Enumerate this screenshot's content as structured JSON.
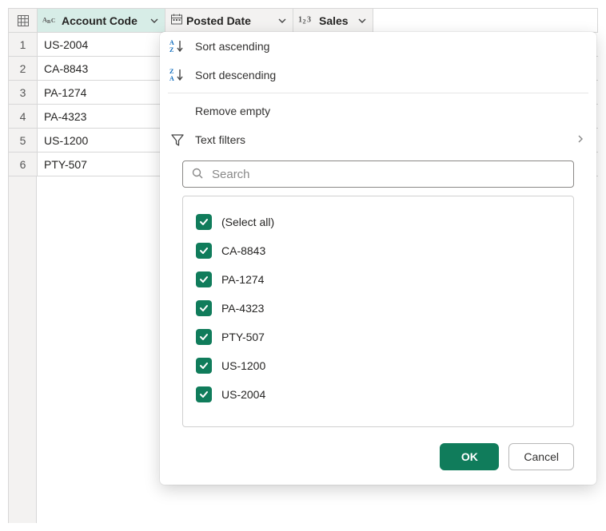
{
  "columns": {
    "account": {
      "label": "Account Code"
    },
    "posted": {
      "label": "Posted Date"
    },
    "sales": {
      "label": "Sales"
    }
  },
  "rows": [
    {
      "num": "1",
      "account": "US-2004"
    },
    {
      "num": "2",
      "account": "CA-8843"
    },
    {
      "num": "3",
      "account": "PA-1274"
    },
    {
      "num": "4",
      "account": "PA-4323"
    },
    {
      "num": "5",
      "account": "US-1200"
    },
    {
      "num": "6",
      "account": "PTY-507"
    }
  ],
  "filter_menu": {
    "sort_asc": "Sort ascending",
    "sort_desc": "Sort descending",
    "remove_empty": "Remove empty",
    "text_filters": "Text filters",
    "search_placeholder": "Search",
    "values": [
      "(Select all)",
      "CA-8843",
      "PA-1274",
      "PA-4323",
      "PTY-507",
      "US-1200",
      "US-2004"
    ],
    "ok": "OK",
    "cancel": "Cancel"
  }
}
